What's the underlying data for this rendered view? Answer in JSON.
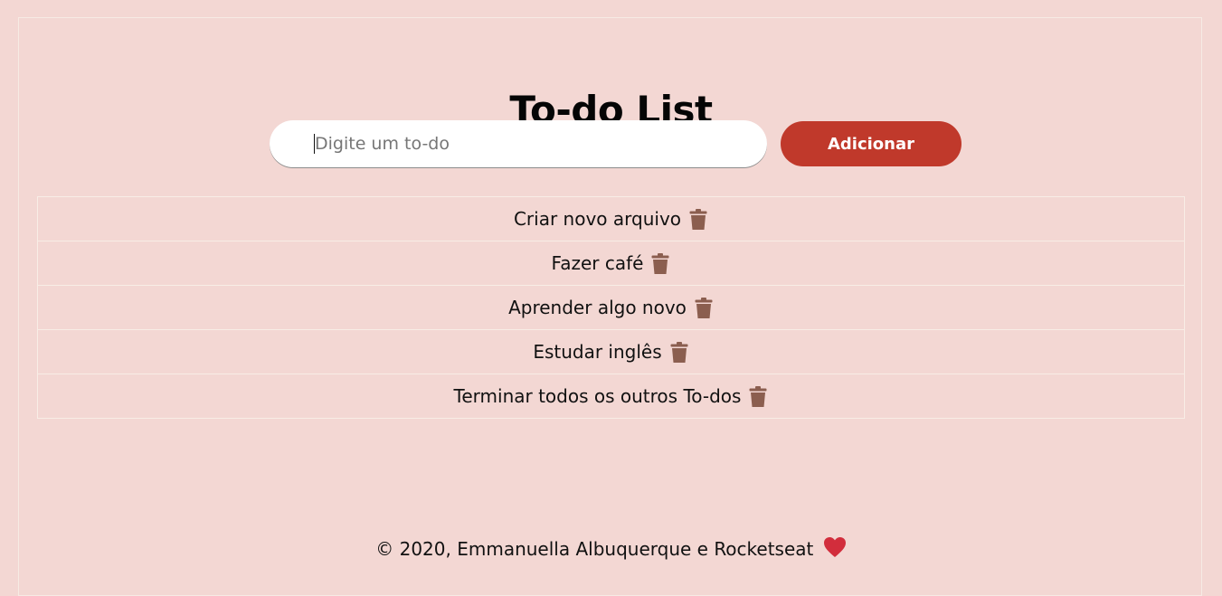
{
  "app": {
    "title": "To-do List"
  },
  "form": {
    "input_value": "",
    "input_placeholder": "Digite um to-do",
    "add_label": "Adicionar"
  },
  "todos": [
    {
      "text": "Criar novo arquivo",
      "icon": "trash-icon"
    },
    {
      "text": "Fazer café",
      "icon": "trash-icon"
    },
    {
      "text": "Aprender algo novo",
      "icon": "trash-icon"
    },
    {
      "text": "Estudar inglês",
      "icon": "trash-icon"
    },
    {
      "text": "Terminar todos os outros To-dos",
      "icon": "trash-icon"
    }
  ],
  "footer": {
    "text": "© 2020, Emmanuella Albuquerque e Rocketseat",
    "icon": "heart-icon"
  },
  "colors": {
    "background": "#f3d7d3",
    "accent": "#c0392b",
    "trash": "#8b5e4f",
    "heart": "#d22d3c"
  }
}
